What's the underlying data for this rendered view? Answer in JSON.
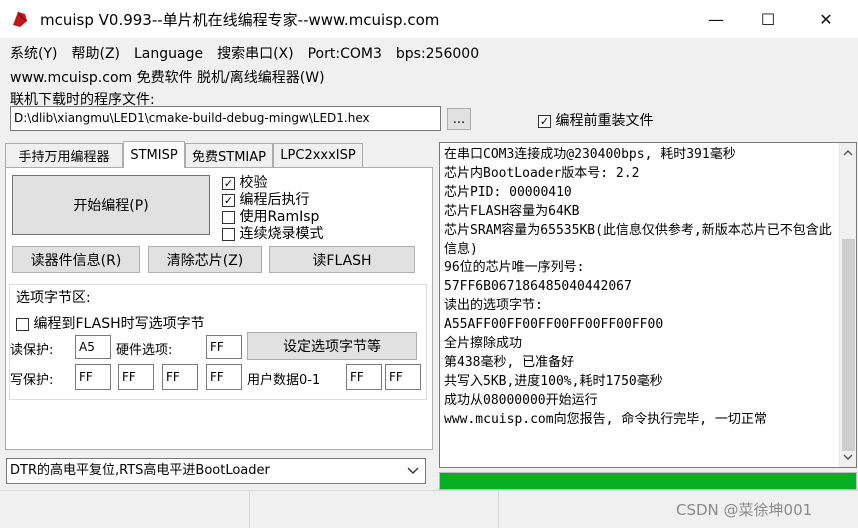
{
  "window": {
    "title": "mcuisp V0.993--单片机在线编程专家--www.mcuisp.com",
    "minimize_glyph": "—",
    "maximize_glyph": "☐",
    "close_glyph": "✕"
  },
  "menu_line1": [
    "系统(Y)",
    "帮助(Z)",
    "Language",
    "搜索串口(X)",
    "Port:COM3",
    "bps:256000"
  ],
  "menu_line2": "www.mcuisp.com 免费软件 脱机/离线编程器(W)",
  "file": {
    "label": "联机下载时的程序文件:",
    "path": "D:\\dlib\\xiangmu\\LED1\\cmake-build-debug-mingw\\LED1.hex",
    "browse": "...",
    "reload_label": "编程前重装文件",
    "reload_checked": "✓"
  },
  "tabs": [
    "手持万用编程器",
    "STMISP",
    "免费STMIAP",
    "LPC2xxxISP"
  ],
  "stmisp": {
    "start": "开始编程(P)",
    "checks": [
      {
        "label": "校验",
        "mark": "✓"
      },
      {
        "label": "编程后执行",
        "mark": "✓"
      },
      {
        "label": "使用RamIsp",
        "mark": ""
      },
      {
        "label": "连续烧录模式",
        "mark": ""
      }
    ],
    "read_info": "读器件信息(R)",
    "erase": "清除芯片(Z)",
    "read_flash": "读FLASH"
  },
  "option_bytes": {
    "group_title": "选项字节区:",
    "program_opt": "编程到FLASH时写选项字节",
    "read_protect_label": "读保护:",
    "read_protect": "A5",
    "hw_option_label": "硬件选项:",
    "hw_option": "FF",
    "set_button": "设定选项字节等",
    "write_protect_label": "写保护:",
    "write_protect": [
      "FF",
      "FF",
      "FF",
      "FF"
    ],
    "user_data_label": "用户数据0-1",
    "user_data": [
      "FF",
      "FF"
    ]
  },
  "bootloader_select": "DTR的高电平复位,RTS高电平进BootLoader",
  "log_text": "在串口COM3连接成功@230400bps, 耗时391毫秒\n芯片内BootLoader版本号: 2.2\n芯片PID: 00000410\n芯片FLASH容量为64KB\n芯片SRAM容量为65535KB(此信息仅供参考,新版本芯片已不包含此信息)\n96位的芯片唯一序列号:\n57FF6B067186485040442067\n读出的选项字节:\nA55AFF00FF00FF00FF00FF00FF00\n全片擦除成功\n第438毫秒, 已准备好\n共写入5KB,进度100%,耗时1750毫秒\n成功从08000000开始运行\nwww.mcuisp.com向您报告, 命令执行完毕, 一切正常",
  "progress": 1.0,
  "watermark": "CSDN @菜徐坤001",
  "colors": {
    "progress": "#06b025",
    "icon": "#c0181a"
  }
}
